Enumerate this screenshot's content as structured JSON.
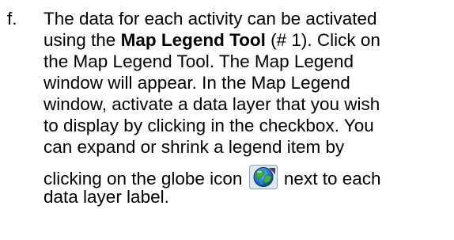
{
  "instruction": {
    "marker": "f.",
    "lines": {
      "l1": "The data for each activity can be activated",
      "l2_prefix": "using the ",
      "l2_bold": "Map Legend Tool",
      "l2_suffix": " (# 1). Click on",
      "l3": "the Map Legend Tool. The Map Legend",
      "l4": "window will appear. In the Map Legend",
      "l5": "window, activate a data layer that you wish",
      "l6": "to display by clicking in the checkbox. You",
      "l7": "can expand or shrink a legend item by",
      "l8_prefix": "clicking on the globe icon ",
      "l8_suffix": " next to each",
      "l9": "data layer label."
    },
    "icon": "globe-icon"
  }
}
